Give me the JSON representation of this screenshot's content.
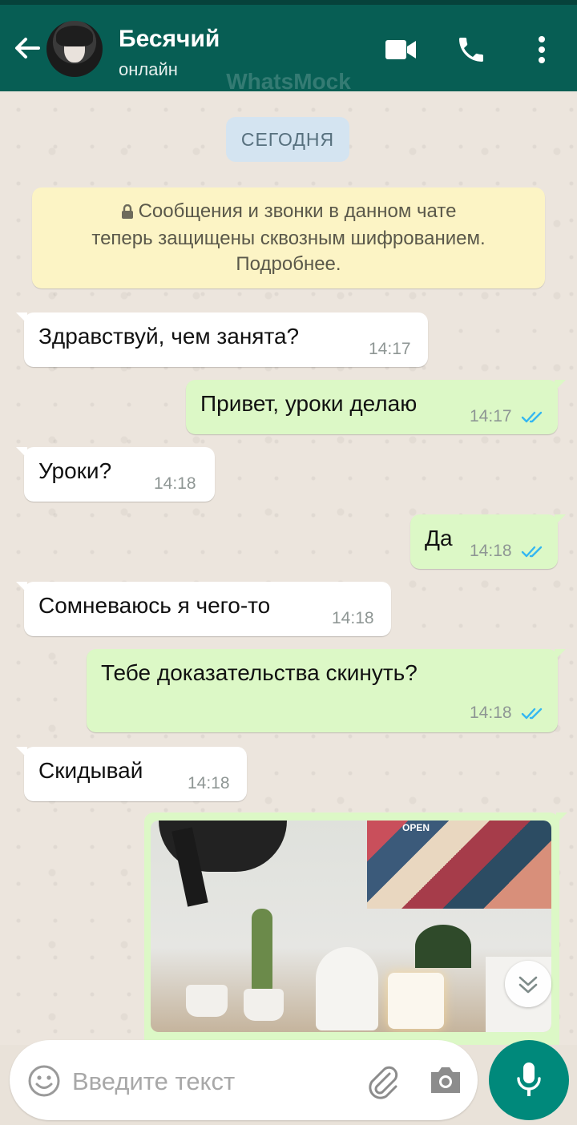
{
  "header": {
    "contact_name": "Бесячий",
    "status": "онлайн",
    "watermark": "WhatsMock",
    "icons": [
      "back-arrow-icon",
      "video-call-icon",
      "phone-call-icon",
      "more-vert-icon"
    ]
  },
  "chat": {
    "date_label": "СЕГОДНЯ",
    "system_notice": {
      "line1": "Сообщения и звонки в данном чате",
      "line2": "теперь защищены сквозным шифрованием.",
      "line3": "Подробнее."
    },
    "messages": [
      {
        "dir": "in",
        "text": "Здравствуй, чем занята?",
        "time": "14:17"
      },
      {
        "dir": "out",
        "text": "Привет, уроки делаю",
        "time": "14:17",
        "read": true
      },
      {
        "dir": "in",
        "text": "Уроки?",
        "time": "14:18"
      },
      {
        "dir": "out",
        "text": "Да",
        "time": "14:18",
        "read": true
      },
      {
        "dir": "in",
        "text": "Сомневаюсь я чего-то",
        "time": "14:18"
      },
      {
        "dir": "out",
        "text": "Тебе доказательства скинуть?",
        "time": "14:18",
        "read": true
      },
      {
        "dir": "in",
        "text": "Скидывай",
        "time": "14:18"
      }
    ],
    "photo_collage_label": "OPEN",
    "read_tick_color": "#34b7f1"
  },
  "input": {
    "placeholder": "Введите текст",
    "icons": [
      "emoji-icon",
      "attach-icon",
      "camera-icon",
      "mic-icon"
    ]
  },
  "colors": {
    "header": "#075e54",
    "outgoing_bubble": "#dcf8c6",
    "incoming_bubble": "#ffffff",
    "mic_button": "#00897b"
  }
}
